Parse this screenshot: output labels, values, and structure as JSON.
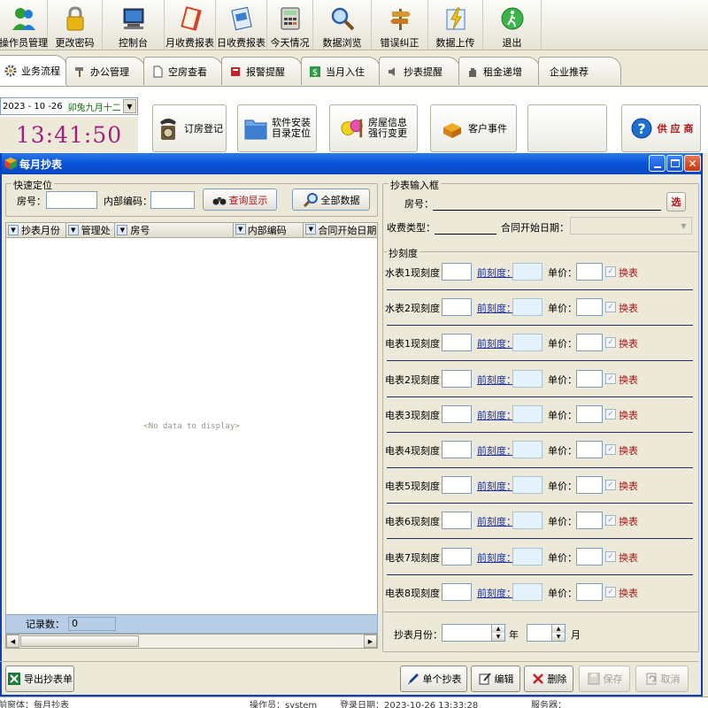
{
  "toolbar": {
    "items": [
      {
        "label": "操作员管理",
        "icon": "users-icon"
      },
      {
        "label": "更改密码",
        "icon": "lock-icon"
      },
      {
        "label": "控制台",
        "icon": "monitor-icon"
      },
      {
        "label": "月收费报表",
        "icon": "book-icon"
      },
      {
        "label": "日收费报表",
        "icon": "report-icon"
      },
      {
        "label": "今天情况",
        "icon": "calculator-icon"
      },
      {
        "label": "数据浏览",
        "icon": "magnifier-icon"
      },
      {
        "label": "错误纠正",
        "icon": "signpost-icon"
      },
      {
        "label": "数据上传",
        "icon": "upload-icon"
      },
      {
        "label": "退出",
        "icon": "exit-icon"
      }
    ]
  },
  "tabs": [
    {
      "label": "业务流程",
      "icon": "gear-icon",
      "active": true
    },
    {
      "label": "办公管理",
      "icon": "hammer-icon"
    },
    {
      "label": "空房查看",
      "icon": "document-icon"
    },
    {
      "label": "报警提醒",
      "icon": "alarm-icon"
    },
    {
      "label": "当月入住",
      "icon": "dollar-icon"
    },
    {
      "label": "抄表提醒",
      "icon": "speaker-icon"
    },
    {
      "label": "租金递增",
      "icon": "hand-icon"
    },
    {
      "label": "企业推荐",
      "icon": ""
    }
  ],
  "panel": {
    "date": "2023 - 10 -26",
    "lunar": "卯兔九月十二",
    "time": "13:41:50",
    "buttons": [
      {
        "label": "订房登记",
        "icon": "telephone-icon"
      },
      {
        "label1": "软件安装",
        "label2": "目录定位",
        "icon": "folder-icon"
      },
      {
        "label1": "房屋信息",
        "label2": "强行变更",
        "icon": "faces-icon"
      },
      {
        "label": "客户事件",
        "icon": "boxes-icon"
      },
      {
        "label": ""
      },
      {
        "label": "供 应 商",
        "icon": "help-icon"
      }
    ]
  },
  "window": {
    "title": "每月抄表",
    "quick": {
      "title": "快速定位",
      "room_label": "房号：",
      "code_label": "内部编码：",
      "query_label": "查询显示",
      "all_label": "全部数据"
    },
    "grid": {
      "columns": [
        "抄表月份",
        "管理处",
        "房号",
        "内部编码",
        "合同开始日期"
      ],
      "empty_text": "<No data to display>",
      "count_label": "记录数：",
      "count_value": "0"
    },
    "input": {
      "title": "抄表输入框",
      "room_label": "房号：",
      "select_label": "选",
      "fee_type_label": "收费类型：",
      "contract_start_label": "合同开始日期："
    },
    "meters": {
      "title": "抄刻度",
      "prev_label": "前刻度：",
      "price_label": "单价：",
      "swap_label": "换表",
      "rows": [
        {
          "label": "水表1现刻度："
        },
        {
          "label": "水表2现刻度："
        },
        {
          "label": "电表1现刻度："
        },
        {
          "label": "电表2现刻度："
        },
        {
          "label": "电表3现刻度："
        },
        {
          "label": "电表4现刻度："
        },
        {
          "label": "电表5现刻度："
        },
        {
          "label": "电表6现刻度："
        },
        {
          "label": "电表7现刻度："
        },
        {
          "label": "电表8现刻度："
        }
      ]
    },
    "month": {
      "label": "抄表月份：",
      "year_label": "年",
      "month_label": "月"
    },
    "buttons": {
      "export": "导出抄表单",
      "single": "单个抄表",
      "edit": "编辑",
      "delete": "删除",
      "save": "保存",
      "cancel": "取消"
    }
  },
  "status": {
    "part1": "前窗体：每月抄表",
    "part2": "操作员：system",
    "part3": "登录日期：2023-10-26 13:33:28",
    "part4": "服务器："
  }
}
